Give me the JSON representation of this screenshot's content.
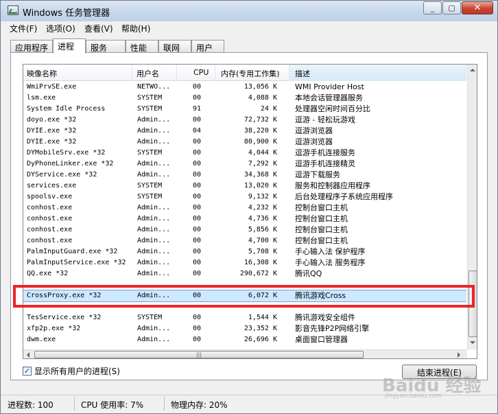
{
  "window": {
    "title": "Windows 任务管理器",
    "controls": {
      "minimize": "_",
      "maximize": "▢",
      "close": "✕"
    }
  },
  "menu": [
    "文件(F)",
    "选项(O)",
    "查看(V)",
    "帮助(H)"
  ],
  "tabs": [
    "应用程序",
    "进程",
    "服务",
    "性能",
    "联网",
    "用户"
  ],
  "active_tab": "进程",
  "columns": [
    "映像名称",
    "用户名",
    "CPU",
    "内存(专用工作集)",
    "描述"
  ],
  "processes": [
    {
      "name": "WmiPrvSE.exe",
      "user": "NETWO...",
      "cpu": "00",
      "mem": "13,056 K",
      "desc": "WMI Provider Host"
    },
    {
      "name": "lsm.exe",
      "user": "SYSTEM",
      "cpu": "00",
      "mem": "4,088 K",
      "desc": "本地会话管理器服务"
    },
    {
      "name": "System Idle Process",
      "user": "SYSTEM",
      "cpu": "91",
      "mem": "24 K",
      "desc": "处理器空闲时间百分比"
    },
    {
      "name": "doyo.exe *32",
      "user": "Admin...",
      "cpu": "00",
      "mem": "72,732 K",
      "desc": "逗游 - 轻松玩游戏"
    },
    {
      "name": "DYIE.exe *32",
      "user": "Admin...",
      "cpu": "04",
      "mem": "38,220 K",
      "desc": "逗游浏览器"
    },
    {
      "name": "DYIE.exe *32",
      "user": "Admin...",
      "cpu": "00",
      "mem": "80,900 K",
      "desc": "逗游浏览器"
    },
    {
      "name": "DYMobileSrv.exe *32",
      "user": "SYSTEM",
      "cpu": "00",
      "mem": "4,044 K",
      "desc": "逗游手机连接服务"
    },
    {
      "name": "DyPhoneLinker.exe *32",
      "user": "Admin...",
      "cpu": "00",
      "mem": "7,292 K",
      "desc": "逗游手机连接精灵"
    },
    {
      "name": "DYService.exe *32",
      "user": "Admin...",
      "cpu": "00",
      "mem": "34,368 K",
      "desc": "逗游下载服务"
    },
    {
      "name": "services.exe",
      "user": "SYSTEM",
      "cpu": "00",
      "mem": "13,020 K",
      "desc": "服务和控制器应用程序"
    },
    {
      "name": "spoolsv.exe",
      "user": "SYSTEM",
      "cpu": "00",
      "mem": "9,132 K",
      "desc": "后台处理程序子系统应用程序"
    },
    {
      "name": "conhost.exe",
      "user": "Admin...",
      "cpu": "00",
      "mem": "4,232 K",
      "desc": "控制台窗口主机"
    },
    {
      "name": "conhost.exe",
      "user": "Admin...",
      "cpu": "00",
      "mem": "4,736 K",
      "desc": "控制台窗口主机"
    },
    {
      "name": "conhost.exe",
      "user": "Admin...",
      "cpu": "00",
      "mem": "5,856 K",
      "desc": "控制台窗口主机"
    },
    {
      "name": "conhost.exe",
      "user": "Admin...",
      "cpu": "00",
      "mem": "4,700 K",
      "desc": "控制台窗口主机"
    },
    {
      "name": "PalmInputGuard.exe *32",
      "user": "Admin...",
      "cpu": "00",
      "mem": "5,708 K",
      "desc": "手心输入法 保护程序"
    },
    {
      "name": "PalmInputService.exe *32",
      "user": "Admin...",
      "cpu": "00",
      "mem": "16,308 K",
      "desc": "手心输入法 服务程序"
    },
    {
      "name": "QQ.exe *32",
      "user": "Admin...",
      "cpu": "00",
      "mem": "290,672 K",
      "desc": "腾讯QQ"
    },
    {
      "name": "",
      "user": "",
      "cpu": "",
      "mem": "",
      "desc": ""
    },
    {
      "name": "CrossProxy.exe *32",
      "user": "Admin...",
      "cpu": "00",
      "mem": "6,072 K",
      "desc": "腾讯游戏Cross"
    },
    {
      "name": "",
      "user": "",
      "cpu": "",
      "mem": "",
      "desc": ""
    },
    {
      "name": "TesService.exe *32",
      "user": "SYSTEM",
      "cpu": "00",
      "mem": "1,544 K",
      "desc": "腾讯游戏安全组件"
    },
    {
      "name": "xfp2p.exe *32",
      "user": "Admin...",
      "cpu": "00",
      "mem": "23,352 K",
      "desc": "影音先锋P2P网络引擎"
    },
    {
      "name": "dwm.exe",
      "user": "Admin...",
      "cpu": "00",
      "mem": "26,696 K",
      "desc": "桌面窗口管理器"
    }
  ],
  "selected_index": 19,
  "show_all_users": {
    "label": "显示所有用户的进程(S)",
    "checked": "✓"
  },
  "end_process_label": "结束进程(E)",
  "scroll_grip": "|||",
  "status": {
    "process_count": "进程数: 100",
    "cpu_usage": "CPU 使用率: 7%",
    "physical_memory": "物理内存: 20%"
  },
  "watermark": {
    "logo": "Baidu 经验",
    "url": "jingyan.baidu.com"
  },
  "colors": {
    "highlight_border": "#e8252a",
    "selected_row": "#cde8ff"
  }
}
